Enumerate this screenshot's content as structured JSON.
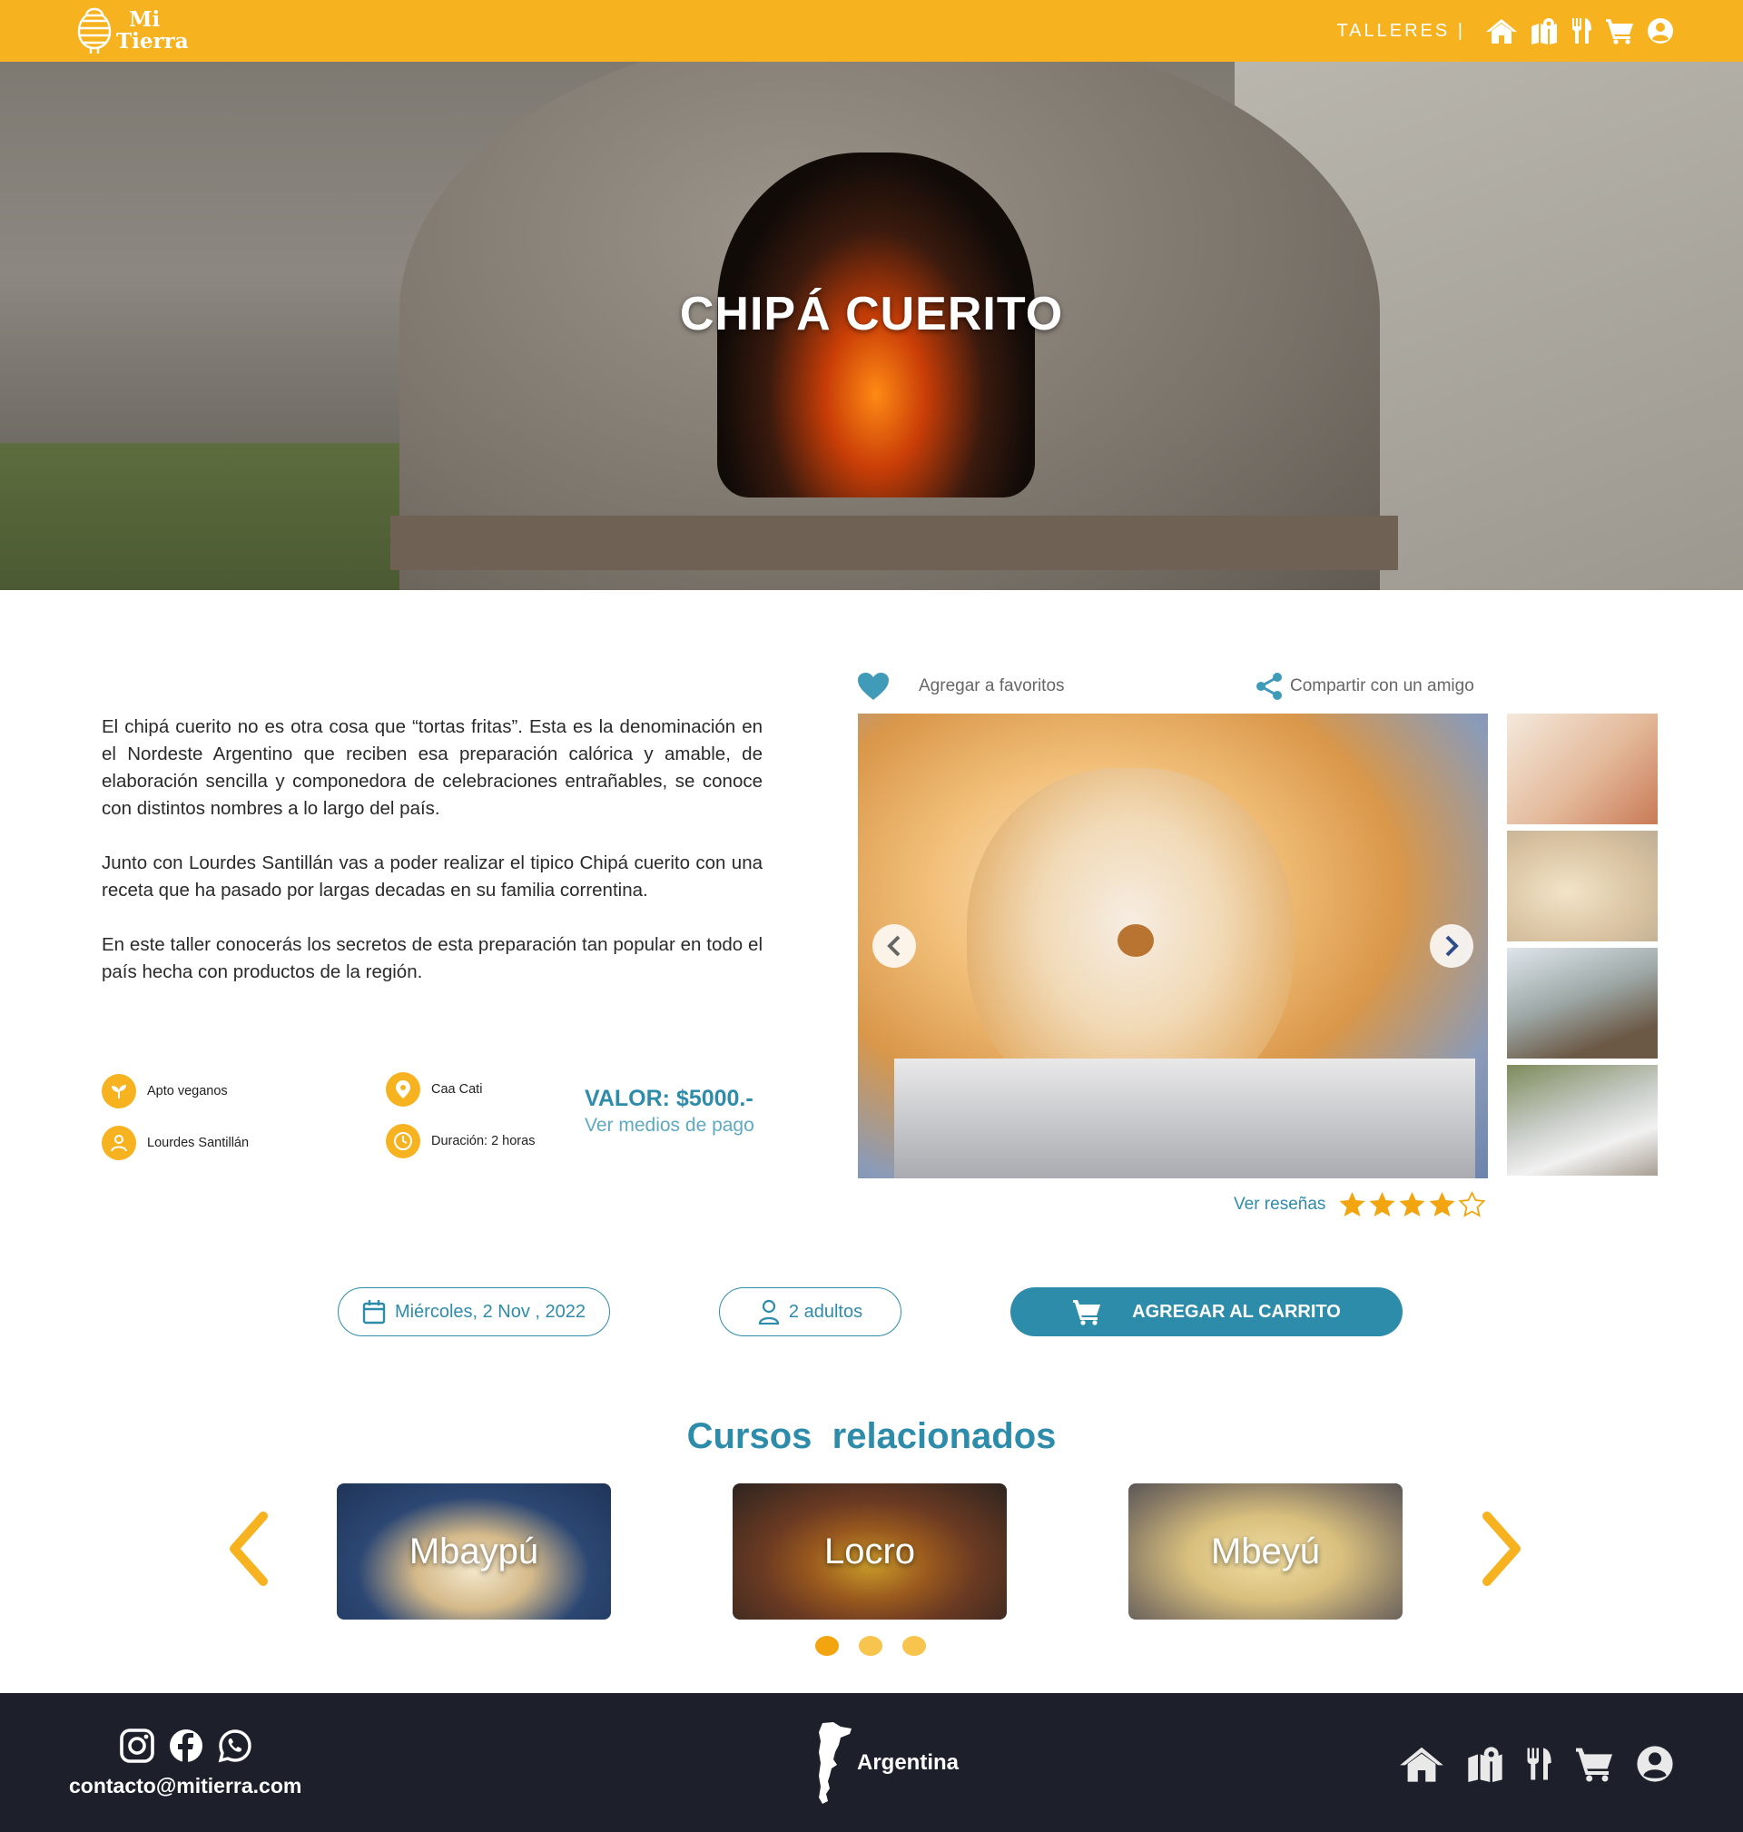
{
  "brand": {
    "line1": "Mi",
    "line2": "Tierra"
  },
  "topnav": {
    "label": "TALLERES |",
    "icons": [
      "home-icon",
      "map-icon",
      "utensils-icon",
      "cart-icon",
      "user-icon"
    ]
  },
  "hero": {
    "title": "CHIPÁ CUERITO"
  },
  "description": {
    "p1": "El chipá cuerito no es otra cosa que “tortas fritas”. Esta es la denominación en el Nordeste Argentino que reciben esa preparación calórica y amable, de elaboración sencilla y componedora de celebraciones entrañables, se conoce con distintos nombres a lo largo del país.",
    "p2": "Junto con Lourdes Santillán vas a poder realizar el tipico Chipá cuerito con una receta que ha pasado por largas decadas en su familia correntina.",
    "p3": "En este taller conocerás los secretos de esta preparación tan popular en todo el país hecha con productos de la región."
  },
  "info": {
    "vegan": "Apto veganos",
    "location": "Caa Cati",
    "teacher": "Lourdes Santillán",
    "duration": "Duración: 2 horas",
    "price": "VALOR: $5000.-",
    "payment_link": "Ver medios de pago"
  },
  "gallery": {
    "favorite": "Agregar a favoritos",
    "share": "Compartir con un amigo",
    "reviews_link": "Ver reseñas",
    "rating": 4,
    "rating_max": 5
  },
  "booking": {
    "date": "Miércoles, 2 Nov , 2022",
    "guests": "2 adultos",
    "add_to_cart": "AGREGAR AL CARRITO"
  },
  "related": {
    "title": "Cursos  relacionados",
    "cards": [
      "Mbaypú",
      "Locro",
      "Mbeyú"
    ],
    "pages": 3,
    "active_page": 1
  },
  "footer": {
    "email": "contacto@mitierra.com",
    "country": "Argentina",
    "social": [
      "instagram-icon",
      "facebook-icon",
      "whatsapp-icon"
    ]
  },
  "colors": {
    "accent": "#f7b220",
    "primary": "#2e8cab",
    "footer": "#1d1f2b"
  }
}
